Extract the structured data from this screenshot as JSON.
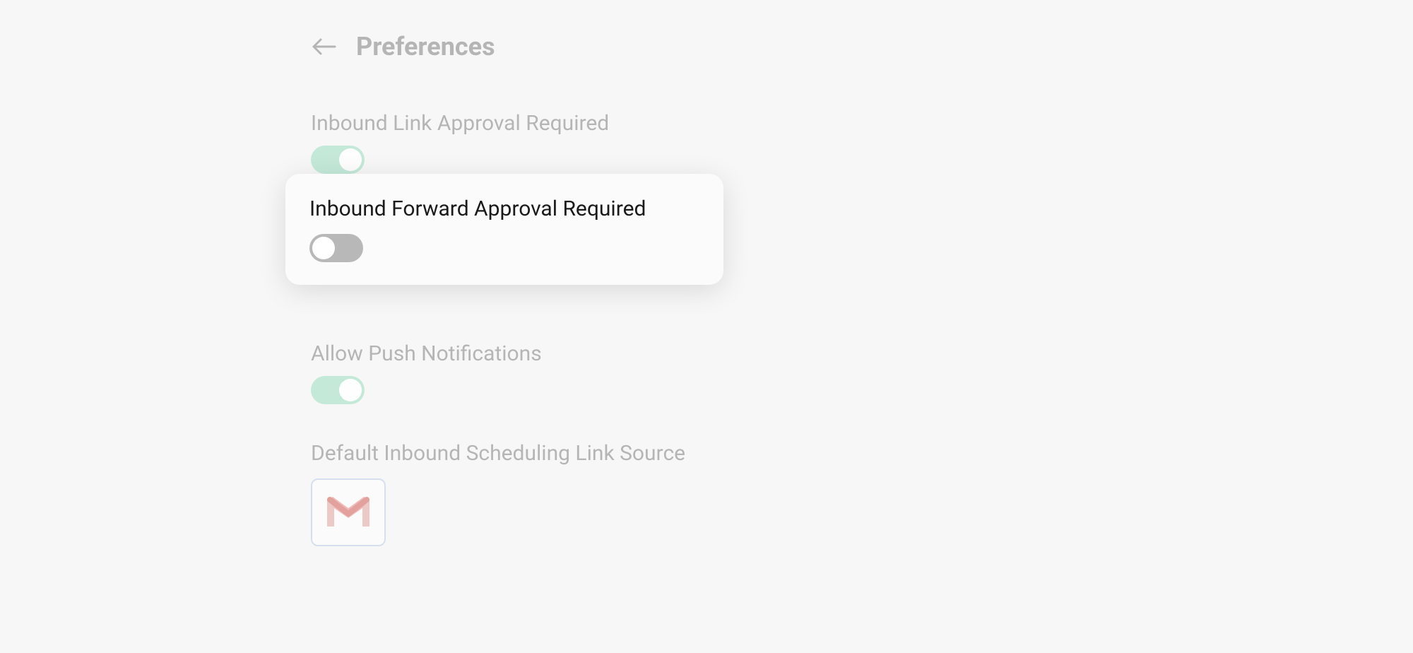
{
  "header": {
    "title": "Preferences"
  },
  "settings": {
    "inboundLinkApproval": {
      "label": "Inbound Link Approval Required",
      "enabled": true
    },
    "inboundForwardApproval": {
      "label": "Inbound Forward Approval Required",
      "enabled": false
    },
    "allowPushNotifications": {
      "label": "Allow Push Notifications",
      "enabled": true
    },
    "defaultSchedulingLinkSource": {
      "label": "Default Inbound Scheduling Link Source",
      "source": "gmail"
    }
  }
}
